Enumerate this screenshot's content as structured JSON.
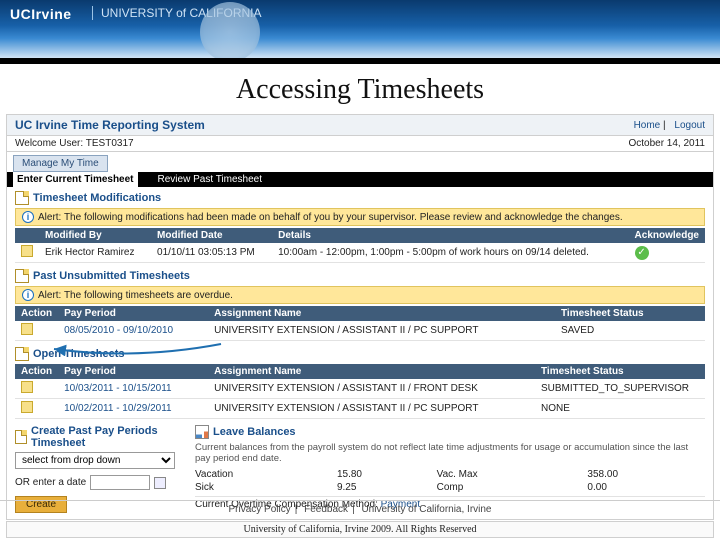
{
  "banner": {
    "wordmark": "UCIrvine",
    "subtitle": "UNIVERSITY of CALIFORNIA"
  },
  "slide": {
    "title": "Accessing Timesheets"
  },
  "app": {
    "title": "UC Irvine Time Reporting System",
    "links": {
      "home": "Home",
      "logout": "Logout"
    },
    "welcome_prefix": "Welcome User: ",
    "welcome_user": "TEST0317",
    "date": "October 14, 2011"
  },
  "tabs": {
    "manage": "Manage My Time"
  },
  "subtabs": {
    "enter": "Enter Current Timesheet",
    "review": "Review Past Timesheet"
  },
  "mods": {
    "heading": "Timesheet Modifications",
    "alert": "Alert: The following modifications had been made on behalf of you by your supervisor. Please review and acknowledge the changes.",
    "cols": {
      "by": "Modified By",
      "date": "Modified Date",
      "details": "Details",
      "ack": "Acknowledge"
    },
    "row": {
      "by": "Erik Hector Ramirez",
      "date": "01/10/11 03:05:13 PM",
      "details": "10:00am - 12:00pm, 1:00pm - 5:00pm of work hours on 09/14 deleted."
    }
  },
  "past": {
    "heading": "Past Unsubmitted Timesheets",
    "alert": "Alert: The following timesheets are overdue.",
    "cols": {
      "action": "Action",
      "period": "Pay Period",
      "assign": "Assignment Name",
      "status": "Timesheet Status"
    },
    "row": {
      "period": "08/05/2010 - 09/10/2010",
      "assign": "UNIVERSITY EXTENSION / ASSISTANT II / PC SUPPORT",
      "status": "SAVED"
    }
  },
  "open": {
    "heading": "Open Timesheets",
    "cols": {
      "action": "Action",
      "period": "Pay Period",
      "assign": "Assignment Name",
      "status": "Timesheet Status"
    },
    "rows": [
      {
        "period": "10/03/2011 - 10/15/2011",
        "assign": "UNIVERSITY EXTENSION / ASSISTANT II / FRONT DESK",
        "status": "SUBMITTED_TO_SUPERVISOR"
      },
      {
        "period": "10/02/2011 - 10/29/2011",
        "assign": "UNIVERSITY EXTENSION / ASSISTANT II / PC SUPPORT",
        "status": "NONE"
      }
    ]
  },
  "create": {
    "heading": "Create Past Pay Periods Timesheet",
    "dropdown_placeholder": "select from drop down",
    "or_label": "OR enter a date",
    "button": "Create"
  },
  "balances": {
    "heading": "Leave Balances",
    "note": "Current balances from the payroll system do not reflect late time adjustments for usage or accumulation since the last pay period end date.",
    "rows": [
      {
        "k1": "Vacation",
        "v1": "15.80",
        "k2": "Vac. Max",
        "v2": "358.00"
      },
      {
        "k1": "Sick",
        "v1": "9.25",
        "k2": "Comp",
        "v2": "0.00"
      }
    ],
    "ot_label": "Current Overtime Compensation Method:",
    "ot_value": "Payment"
  },
  "footer": {
    "privacy": "Privacy Policy",
    "feedback": "Feedback",
    "uci": "University of California, Irvine"
  },
  "copyright": "University of California, Irvine 2009. All Rights Reserved"
}
